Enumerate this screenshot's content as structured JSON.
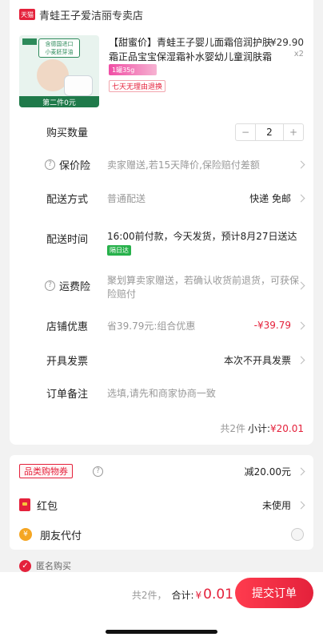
{
  "store": {
    "badge": "天猫",
    "name": "青蛙王子爱洁丽专卖店"
  },
  "product": {
    "image_tag_line1": "含德国进口",
    "image_tag_line2": "小麦胚芽油",
    "image_strip": "第二件0元",
    "title": "【甜蜜价】青蛙王子婴儿面霜倍润护肤霜正品宝宝保湿霜补水婴幼儿童润肤霜",
    "price": "¥29.90",
    "quantity_mark": "x2",
    "spec": "1罐35g",
    "badge": "七天无理由退换"
  },
  "rows": {
    "qty_label": "购买数量",
    "qty_value": "2",
    "qty_minus": "−",
    "qty_plus": "+",
    "ins_label": "保价险",
    "ins_value": "卖家赠送,若15天降价,保险赔付差额",
    "ship_label": "配送方式",
    "ship_value": "普通配送",
    "ship_right": "快递 免邮",
    "time_label": "配送时间",
    "time_value": "16:00前付款，今天发货，预计8月27日送达",
    "time_badge": "隔日达",
    "fee_label": "运费险",
    "fee_value": "聚划算卖家赠送，若确认收货前退货，可获保险赔付",
    "disc_label": "店铺优惠",
    "disc_value": "省39.79元:组合优惠",
    "disc_right": "-¥39.79",
    "invoice_label": "开具发票",
    "invoice_right": "本次不开具发票",
    "note_label": "订单备注",
    "note_placeholder": "选填,请先和商家协商一致"
  },
  "subtotal": {
    "count": "共2件",
    "label": "小计:",
    "amount": "¥20.01"
  },
  "promo": {
    "coupon_label": "品类购物券",
    "coupon_right": "减20.00元",
    "redpacket_label": "红包",
    "redpacket_right": "未使用",
    "friend_label": "朋友代付"
  },
  "anonymous": "匿名购买",
  "footer": {
    "count": "共2件，",
    "total_label": "合计:",
    "currency": "¥",
    "amount": "0.01",
    "submit": "提交订单"
  }
}
